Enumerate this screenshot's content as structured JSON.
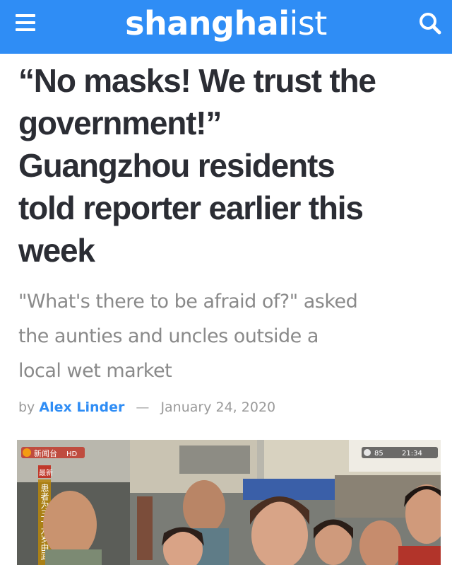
{
  "header": {
    "logo_bold": "shanghai",
    "logo_light": "ist",
    "menu_icon": "hamburger-menu-icon",
    "search_icon": "search-icon",
    "color": "#2f8df5"
  },
  "article": {
    "headline_lines": [
      "“No masks! We trust the",
      "government!”",
      "Guangzhou residents",
      "told reporter earlier this",
      "week"
    ],
    "subhead_lines": [
      "\"What's there to be afraid of?\" asked",
      "the aunties and uncles outside a",
      "local wet market"
    ],
    "byline": {
      "prefix": "by",
      "author": "Alex Linder",
      "separator": "—",
      "date": "January 24, 2020"
    }
  },
  "photo": {
    "channel_label": "新闻台",
    "hd_label": "HD",
    "breaking_label": "最新",
    "temperature": "85",
    "time": "21:34",
    "caption_vertical": "患者为三十九岁由武"
  }
}
